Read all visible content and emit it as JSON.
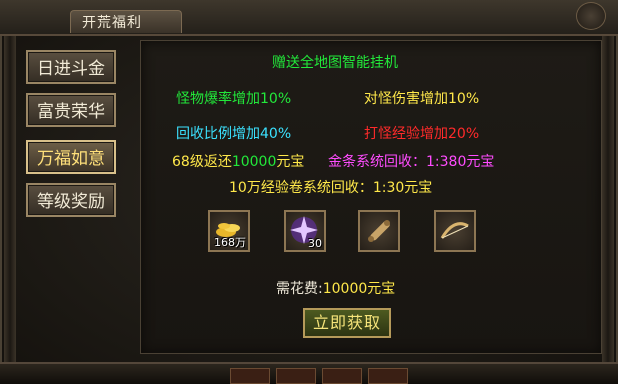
{
  "window": {
    "title": "开荒福利"
  },
  "sidebar": {
    "items": [
      {
        "label": "日进斗金",
        "active": false
      },
      {
        "label": "富贵荣华",
        "active": false
      },
      {
        "label": "万福如意",
        "active": true
      },
      {
        "label": "等级奖励",
        "active": false
      }
    ]
  },
  "content": {
    "headline": "赠送全地图智能挂机",
    "perks": {
      "drop_rate": "怪物爆率增加10%",
      "damage": "对怪伤害增加10%",
      "recycle": "回收比例增加40%",
      "exp": "打怪经验增加20%"
    },
    "rebate": {
      "prefix": "68级返还",
      "amount": "10000",
      "suffix": "元宝"
    },
    "gold_recycle": "金条系统回收：1:380元宝",
    "exp_scroll_recycle": "10万经验卷系统回收：1:30元宝",
    "rewards": [
      {
        "icon": "gold-ingots-icon",
        "count": "168万"
      },
      {
        "icon": "purple-star-crystal-icon",
        "count": "30"
      },
      {
        "icon": "scroll-icon",
        "count": ""
      },
      {
        "icon": "bow-icon",
        "count": ""
      }
    ],
    "cost": {
      "label": "需花费:",
      "value": "10000元宝"
    },
    "claim_button": "立即获取"
  },
  "colors": {
    "green": "#22e83a",
    "yellow": "#ffe84a",
    "cyan": "#3be2ff",
    "red": "#ff2a2a",
    "magenta": "#ff4cff"
  }
}
